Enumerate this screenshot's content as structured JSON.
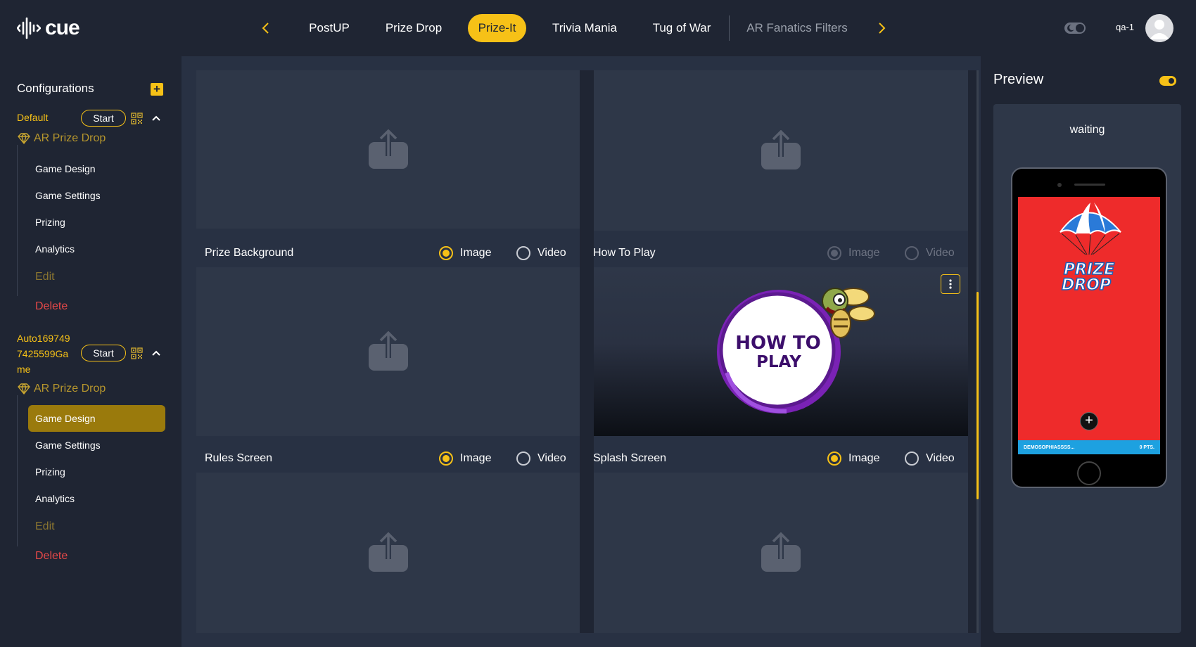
{
  "header": {
    "logo_text": "cue",
    "tabs": [
      {
        "label": "PostUP",
        "active": false
      },
      {
        "label": "Prize Drop",
        "active": false
      },
      {
        "label": "Prize-It",
        "active": true
      },
      {
        "label": "Trivia Mania",
        "active": false
      },
      {
        "label": "Tug of War",
        "active": false
      },
      {
        "label": "AR Fanatics Filters",
        "active": false
      }
    ],
    "user_name": "qa-1",
    "accent_color": "#f6c117"
  },
  "sidebar": {
    "title": "Configurations",
    "configs": [
      {
        "name": "Default",
        "start_label": "Start",
        "game_type": "AR Prize Drop",
        "items": [
          "Game Design",
          "Game Settings",
          "Prizing",
          "Analytics"
        ],
        "edit_label": "Edit",
        "delete_label": "Delete"
      },
      {
        "name_lines": [
          "Auto169749",
          "7425599Ga",
          "me"
        ],
        "start_label": "Start",
        "game_type": "AR Prize Drop",
        "items": [
          "Game Design",
          "Game Settings",
          "Prizing",
          "Analytics"
        ],
        "active_item": "Game Design",
        "edit_label": "Edit",
        "delete_label": "Delete"
      }
    ]
  },
  "main": {
    "sections": [
      {
        "label": "Prize Background",
        "image": "Image",
        "video": "Video",
        "selected": "Image",
        "disabled": false
      },
      {
        "label": "How To Play",
        "image": "Image",
        "video": "Video",
        "selected": "Image",
        "disabled": true,
        "artwork_text": [
          "HOW TO",
          "PLAY"
        ]
      },
      {
        "label": "Rules Screen",
        "image": "Image",
        "video": "Video",
        "selected": "Image",
        "disabled": false
      },
      {
        "label": "Splash Screen",
        "image": "Image",
        "video": "Video",
        "selected": "Image",
        "disabled": false
      }
    ]
  },
  "preview": {
    "title": "Preview",
    "status": "waiting",
    "phone": {
      "logo_text": [
        "PRIZE",
        "DROP"
      ],
      "user_tag": "DEMOSOPHIASSSS...",
      "points": "0 PTS."
    }
  }
}
